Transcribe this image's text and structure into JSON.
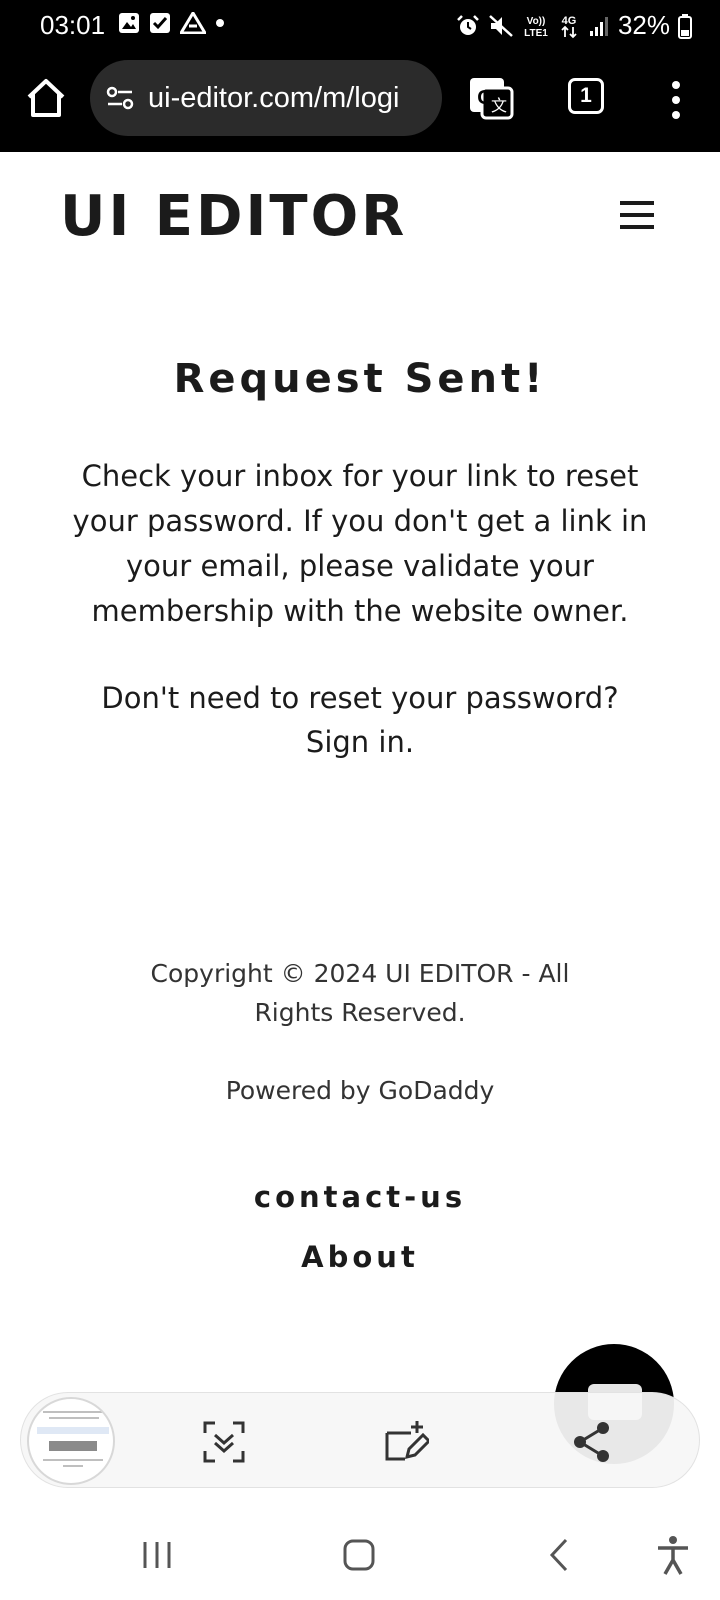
{
  "status_bar": {
    "time": "03:01",
    "battery_percent": "32%",
    "network_label": "4G",
    "volte_label": "VoLTE1",
    "left_icons": [
      "gallery-icon",
      "checkbox-icon",
      "drive-icon",
      "dot-icon"
    ],
    "right_icons": [
      "alarm-icon",
      "mute-icon",
      "volte-icon",
      "network-4g-icon",
      "signal-icon",
      "battery-icon"
    ]
  },
  "browser": {
    "url": "ui-editor.com/m/logi",
    "tab_count": "1",
    "icons": [
      "home-icon",
      "site-info-icon",
      "translate-icon",
      "tabs-icon",
      "more-vert-icon"
    ]
  },
  "site": {
    "logo": "UI EDITOR",
    "menu_icon": "hamburger-icon"
  },
  "main": {
    "heading": "Request Sent!",
    "message": "Check your inbox for your link to reset your password. If you don't get a link in your email, please validate your membership with the website owner.",
    "reset_question": "Don't need to reset your password?",
    "sign_in": "Sign in."
  },
  "footer": {
    "copyright": "Copyright © 2024 UI EDITOR - All Rights Reserved.",
    "powered_by": "Powered by GoDaddy",
    "links": [
      "contact-us",
      "About"
    ]
  },
  "chat": {
    "icon": "chat-bubble-icon"
  },
  "screenshot_toolbar": {
    "icons": [
      "scroll-capture-icon",
      "edit-capture-icon",
      "share-icon"
    ]
  },
  "nav_bar": {
    "icons": [
      "recents-icon",
      "home-nav-icon",
      "back-icon",
      "accessibility-icon"
    ]
  },
  "colors": {
    "status_bg": "#000000",
    "url_pill": "#2b2b2b",
    "text": "#1b1b1b",
    "page_bg": "#ffffff"
  }
}
